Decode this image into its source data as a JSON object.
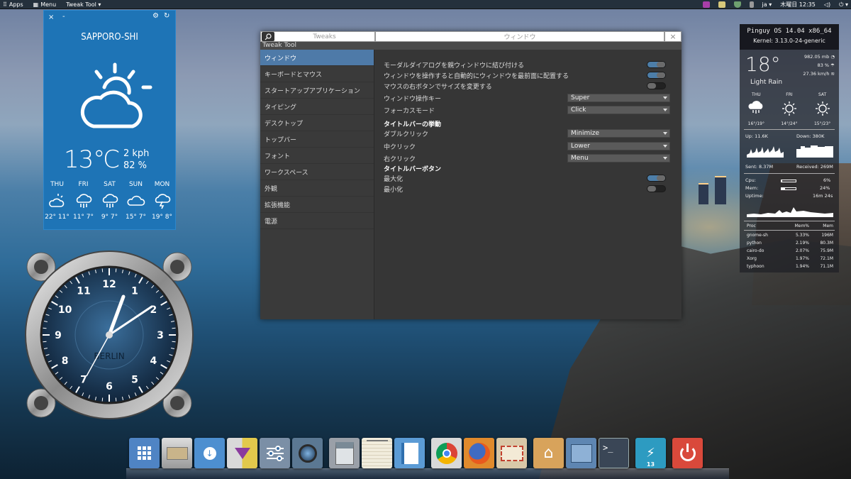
{
  "top_panel": {
    "apps_label": "Apps",
    "menu_label": "Menu",
    "active_app_label": "Tweak Tool ▾",
    "language": "ja ▾",
    "datetime": "木曜日 12:35"
  },
  "weather_left": {
    "close_glyph": "×",
    "minimize_glyph": "-",
    "city": "SAPPORO-SHI",
    "temperature": "13℃",
    "wind": "2 kph",
    "humidity": "82 %",
    "days": [
      {
        "name": "THU",
        "temps": "22° 11°",
        "icon": "partly-sunny-icon"
      },
      {
        "name": "FRI",
        "temps": "11° 7°",
        "icon": "rain-icon"
      },
      {
        "name": "SAT",
        "temps": "9° 7°",
        "icon": "rain-icon"
      },
      {
        "name": "SUN",
        "temps": "15° 7°",
        "icon": "cloud-icon"
      },
      {
        "name": "MON",
        "temps": "19° 8°",
        "icon": "storm-icon"
      }
    ]
  },
  "clock": {
    "brand": "BERLIN",
    "numerals": [
      "12",
      "1",
      "2",
      "3",
      "4",
      "5",
      "6",
      "7",
      "8",
      "9",
      "10",
      "11"
    ],
    "time": "12:35"
  },
  "tweak_tool": {
    "search_placeholder": "Tweaks",
    "window_title": "ウィンドウ",
    "close_glyph": "×",
    "app_name": "Tweak Tool",
    "sidebar": [
      {
        "label": "ウィンドウ",
        "active": true
      },
      {
        "label": "キーボードとマウス",
        "active": false
      },
      {
        "label": "スタートアップアプリケーション",
        "active": false
      },
      {
        "label": "タイピング",
        "active": false
      },
      {
        "label": "デスクトップ",
        "active": false
      },
      {
        "label": "トップバー",
        "active": false
      },
      {
        "label": "フォント",
        "active": false
      },
      {
        "label": "ワークスペース",
        "active": false
      },
      {
        "label": "外観",
        "active": false
      },
      {
        "label": "拡張機能",
        "active": false
      },
      {
        "label": "電源",
        "active": false
      }
    ],
    "settings": {
      "attach_modal": {
        "label": "モーダルダイアログを親ウィンドウに結び付ける",
        "on": true
      },
      "auto_raise": {
        "label": "ウィンドウを操作すると自動的にウィンドウを最前面に配置する",
        "on": true
      },
      "resize_right": {
        "label": "マウスの右ボタンでサイズを変更する",
        "on": false
      },
      "action_key": {
        "label": "ウィンドウ操作キー",
        "value": "Super"
      },
      "focus_mode": {
        "label": "フォーカスモード",
        "value": "Click"
      },
      "titlebar_section": "タイトルバーの挙動",
      "double_click": {
        "label": "ダブルクリック",
        "value": "Minimize"
      },
      "middle_click": {
        "label": "中クリック",
        "value": "Lower"
      },
      "right_click": {
        "label": "右クリック",
        "value": "Menu"
      },
      "buttons_section": "タイトルバーボタン",
      "maximize": {
        "label": "最大化",
        "on": true
      },
      "minimize": {
        "label": "最小化",
        "on": false
      }
    }
  },
  "sysmon": {
    "hostname": "Pinguy OS 14.04 x86_64",
    "kernel": "Kernel: 3.13.0-24-generic",
    "temperature": "18°",
    "condition": "Light Rain",
    "pressure": "982.05 mb",
    "humidity": "83 %",
    "wind": "27.36 km/h",
    "days": [
      {
        "name": "THU",
        "temps": "16°/19°",
        "icon": "rain-icon"
      },
      {
        "name": "FRI",
        "temps": "14°/24°",
        "icon": "sun-icon"
      },
      {
        "name": "SAT",
        "temps": "15°/23°",
        "icon": "sun-icon"
      }
    ],
    "up": "Up: 11.6K",
    "down": "Down: 380K",
    "sent": "Sent: 8.37M",
    "received": "Received: 269M",
    "cpu_label": "Cpu:",
    "cpu_value": "6%",
    "cpu_fraction": 0.06,
    "mem_label": "Mem:",
    "mem_value": "24%",
    "mem_fraction": 0.24,
    "uptime_label": "Uptime:",
    "uptime_value": "16m 24s",
    "proc_header": [
      "Proc",
      "Mem%",
      "Mem"
    ],
    "processes": [
      [
        "gnome-sh",
        "5.33%",
        "196M"
      ],
      [
        "python",
        "2.19%",
        "80.3M"
      ],
      [
        "cairo-do",
        "2.07%",
        "75.9M"
      ],
      [
        "Xorg",
        "1.97%",
        "72.1M"
      ],
      [
        "typhoon",
        "1.94%",
        "71.1M"
      ]
    ]
  },
  "dock": {
    "items": [
      {
        "name": "app-grid",
        "color": "#4f84c4"
      },
      {
        "name": "files",
        "color": "#b7b7b7"
      },
      {
        "name": "download",
        "color": "#4d8fd0"
      },
      {
        "name": "software-center",
        "color": "#e2c94c"
      },
      {
        "name": "settings",
        "color": "#7b8fa6"
      },
      {
        "name": "camera",
        "color": "#5b7893"
      },
      {
        "name": "calculator",
        "color": "#9aa0a8"
      },
      {
        "name": "notes",
        "color": "#e8e3d4"
      },
      {
        "name": "writer",
        "color": "#5b9bd5"
      },
      {
        "name": "chrome",
        "color": "#e0e0e0"
      },
      {
        "name": "firefox",
        "color": "#e08a2c"
      },
      {
        "name": "mail",
        "color": "#d9c8a8"
      },
      {
        "name": "home-folder",
        "color": "#d8a35b"
      },
      {
        "name": "file-manager",
        "color": "#5e86b2"
      },
      {
        "name": "terminal",
        "color": "#3a4656"
      },
      {
        "name": "weather",
        "color": "#2d9bc1",
        "badge": "13"
      },
      {
        "name": "power",
        "color": "#d9493b"
      }
    ]
  }
}
